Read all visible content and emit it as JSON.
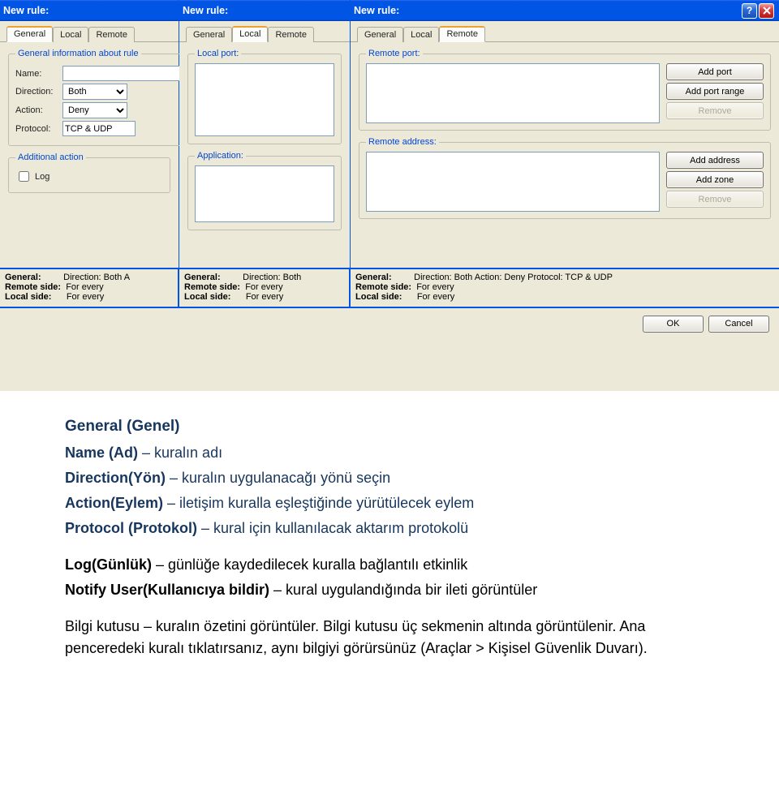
{
  "windows": [
    {
      "title": "New rule:",
      "activeTab": "General",
      "tabs": [
        "General",
        "Local",
        "Remote"
      ]
    },
    {
      "title": "New rule:",
      "activeTab": "Local",
      "tabs": [
        "General",
        "Local",
        "Remote"
      ]
    },
    {
      "title": "New rule:",
      "activeTab": "Remote",
      "tabs": [
        "General",
        "Local",
        "Remote"
      ]
    }
  ],
  "general": {
    "group_label": "General information about rule",
    "name_label": "Name:",
    "name_value": "",
    "direction_label": "Direction:",
    "direction_value": "Both",
    "action_label": "Action:",
    "action_value": "Deny",
    "protocol_label": "Protocol:",
    "protocol_value": "TCP & UDP",
    "additional_label": "Additional action",
    "log_label": "Log"
  },
  "local": {
    "port_label": "Local port:",
    "app_label": "Application:"
  },
  "remote": {
    "port_label": "Remote port:",
    "addr_label": "Remote address:",
    "btn_add_port": "Add port",
    "btn_add_port_range": "Add port range",
    "btn_remove": "Remove",
    "btn_add_address": "Add address",
    "btn_add_zone": "Add zone"
  },
  "status": {
    "panels": [
      {
        "lines": [
          {
            "k": "General:",
            "v": "Direction: Both  A"
          },
          {
            "k": "Remote side:",
            "v": "For every"
          },
          {
            "k": "Local side:",
            "v": "For every"
          }
        ]
      },
      {
        "lines": [
          {
            "k": "General:",
            "v": "Direction: Both"
          },
          {
            "k": "Remote side:",
            "v": "For every"
          },
          {
            "k": "Local side:",
            "v": "For every"
          }
        ]
      },
      {
        "lines": [
          {
            "k": "General:",
            "v": "Direction: Both  Action: Deny  Protocol: TCP & UDP"
          },
          {
            "k": "Remote side:",
            "v": "For every"
          },
          {
            "k": "Local side:",
            "v": "For every"
          }
        ]
      }
    ]
  },
  "buttons": {
    "ok": "OK",
    "cancel": "Cancel"
  },
  "doc": {
    "h_general": "General (Genel)",
    "l_name": "Name (Ad) – kuralın adı",
    "l_direction": "Direction(Yön) – kuralın uygulanacağı yönü seçin",
    "l_action": "Action(Eylem) – iletişim kuralla eşleştiğinde yürütülecek eylem",
    "l_protocol": "Protocol (Protokol) – kural için kullanılacak aktarım protokolü",
    "l_log": "Log(Günlük) – günlüğe kaydedilecek kuralla bağlantılı etkinlik",
    "l_notify": "Notify User(Kullanıcıya bildir) – kural uygulandığında bir ileti görüntüler",
    "para": "Bilgi kutusu – kuralın özetini görüntüler. Bilgi kutusu üç sekmenin altında görüntülenir. Ana penceredeki kuralı tıklatırsanız, aynı bilgiyi görürsünüz (Araçlar > Kişisel Güvenlik Duvarı)."
  }
}
